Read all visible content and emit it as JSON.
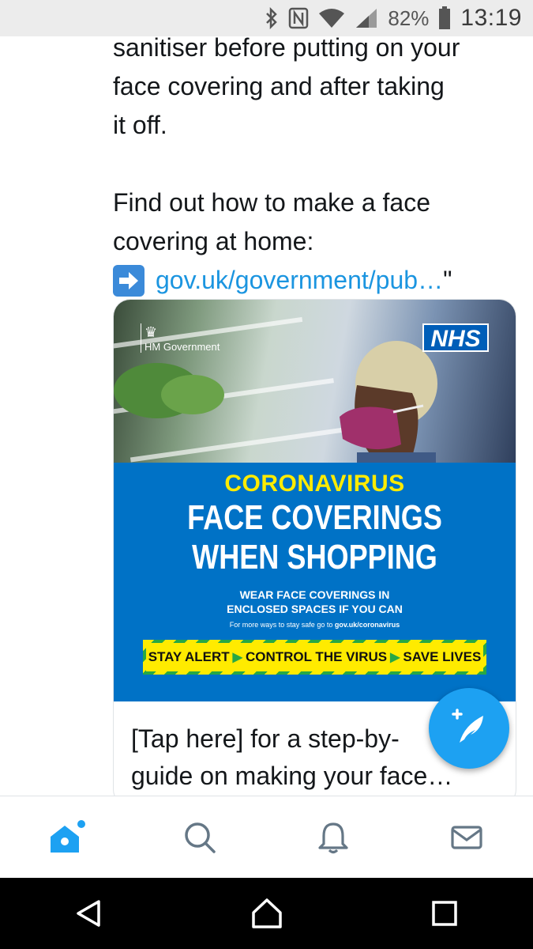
{
  "status_bar": {
    "icons": [
      "bluetooth-icon",
      "nfc-icon",
      "wifi-icon",
      "signal-icon",
      "battery-icon"
    ],
    "battery": "82%",
    "time": "13:19"
  },
  "tweet": {
    "lines_top": [
      "sanitiser before putting on your",
      "face covering and after taking",
      "it off."
    ],
    "lines_find": [
      "Find out how to make a face",
      "covering at home:"
    ],
    "link_text": "gov.uk/government/pub…",
    "link_suffix": "\"",
    "link_icon": "right-arrow-emoji"
  },
  "card": {
    "hm_gov": "HM Government",
    "nhs": "NHS",
    "poster_title": "CORONAVIRUS",
    "poster_headline_1": "FACE COVERINGS",
    "poster_headline_2": "WHEN SHOPPING",
    "poster_sub_1": "WEAR FACE COVERINGS IN",
    "poster_sub_2": "ENCLOSED SPACES IF YOU CAN",
    "poster_small_prefix": "For more ways to stay safe go to",
    "poster_small_link": "gov.uk/coronavirus",
    "alert_1": "STAY ALERT",
    "alert_2": "CONTROL THE VIRUS",
    "alert_3": "SAVE LIVES",
    "caption_1": "[Tap here] for a step-by-",
    "caption_2": "guide on making your face…"
  },
  "tabs": [
    "home-icon",
    "search-icon",
    "notifications-icon",
    "messages-icon"
  ],
  "colors": {
    "accent": "#1da1f2",
    "nhs_blue": "#005eb8",
    "poster_blue": "#0072c6",
    "alert_yellow": "#ffeb00",
    "alert_green": "#27a845"
  }
}
